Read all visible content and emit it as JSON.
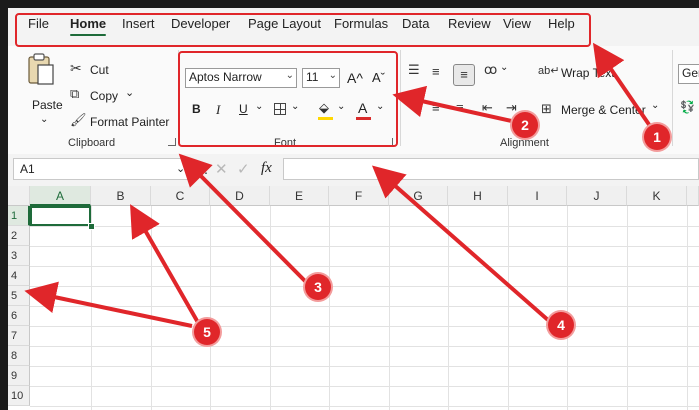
{
  "menu": {
    "tabs": [
      "File",
      "Home",
      "Insert",
      "Developer",
      "Page Layout",
      "Formulas",
      "Data",
      "Review",
      "View",
      "Help"
    ],
    "active": "Home"
  },
  "clipboard": {
    "paste": "Paste",
    "cut": "Cut",
    "copy": "Copy",
    "format_painter": "Format Painter",
    "label": "Clipboard"
  },
  "font": {
    "name": "Aptos Narrow",
    "size": "11",
    "grow": "A^",
    "shrink": "Aˇ",
    "bold": "B",
    "italic": "I",
    "underline": "U",
    "label": "Font",
    "fill_color": "#ffd700",
    "font_color": "#d92b2b"
  },
  "alignment": {
    "wrap_text": "Wrap Text",
    "merge_center": "Merge & Center",
    "label": "Alignment"
  },
  "number": {
    "format": "Gen"
  },
  "formula_bar": {
    "name_box": "A1",
    "fx": "fx",
    "content": ""
  },
  "grid": {
    "columns": [
      "A",
      "B",
      "C",
      "D",
      "E",
      "F",
      "G",
      "H",
      "I",
      "J",
      "K"
    ],
    "rows": [
      "1",
      "2",
      "3",
      "4",
      "5",
      "6",
      "7",
      "8",
      "9",
      "10"
    ]
  },
  "annotations": {
    "badges": [
      "1",
      "2",
      "3",
      "4",
      "5"
    ],
    "color": "#e0262a"
  }
}
